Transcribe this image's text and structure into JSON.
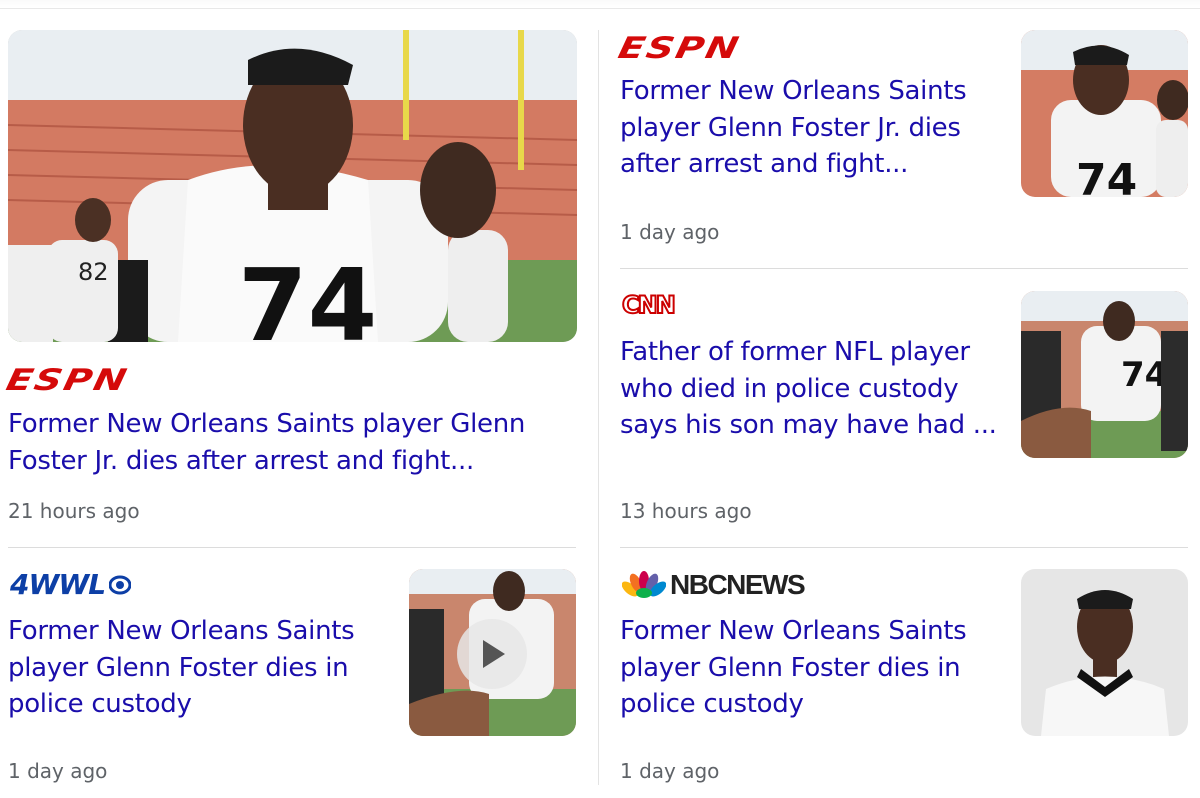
{
  "articles": [
    {
      "source": "ESPN",
      "headline": "Former New Orleans Saints player Glenn Foster Jr. dies after arrest and fight...",
      "time": "21 hours ago"
    },
    {
      "source": "ESPN",
      "headline": "Former New Orleans Saints player Glenn Foster Jr. dies after arrest and fight...",
      "time": "1 day ago"
    },
    {
      "source": "CNN",
      "headline": "Father of former NFL player who died in police custody says his son may have had ...",
      "time": "13 hours ago"
    },
    {
      "source": "4WWL",
      "headline": "Former New Orleans Saints player Glenn Foster dies in police custody",
      "time": "1 day ago",
      "has_video": true
    },
    {
      "source": "NBC NEWS",
      "headline": "Former New Orleans Saints player Glenn Foster dies in police custody",
      "time": "1 day ago"
    }
  ],
  "logos": {
    "espn": "ESPN",
    "cnn": "CNN",
    "wwl": "4WWL",
    "nbc": "NBCNEWS"
  },
  "colors": {
    "headline": "#1a0dab",
    "timestamp": "#5f6368",
    "espn_red": "#d50a0a",
    "cnn_red": "#cc0000",
    "wwl_blue": "#0d3fa6"
  }
}
